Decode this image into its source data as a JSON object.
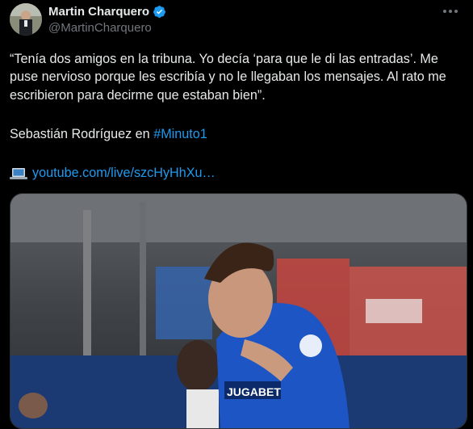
{
  "author": {
    "display_name": "Martin Charquero",
    "handle": "@MartinCharquero",
    "verified": true
  },
  "tweet": {
    "quote_text": "“Tenía dos amigos en la tribuna. Yo decía ‘para que le di las entradas’. Me puse nervioso porque les escribía y no le llegaban los mensajes. Al rato me escribieron para decirme que estaban bien”.",
    "attribution_prefix": "Sebastián Rodríguez en ",
    "hashtag": "#Minuto1",
    "link_text": "youtube.com/live/szcHyHhXu…"
  },
  "media": {
    "sponsor_text": "JUGABET"
  },
  "colors": {
    "background": "#000000",
    "text": "#e7e9ea",
    "secondary": "#71767b",
    "link": "#1d9bf0",
    "verified": "#1d9bf0"
  },
  "icons": {
    "verified": "verified-badge-icon",
    "more": "more-options-icon",
    "link": "laptop-icon"
  }
}
